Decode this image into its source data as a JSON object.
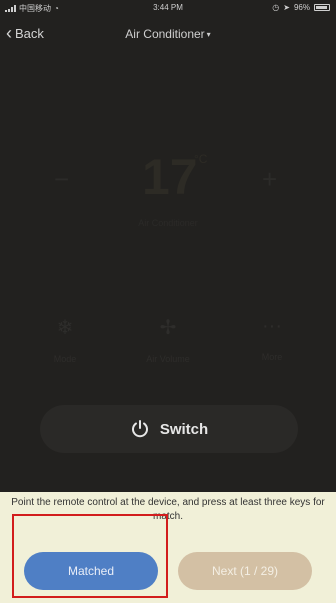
{
  "status_bar": {
    "carrier": "中国移动",
    "time": "3:44 PM",
    "battery": "96%"
  },
  "nav": {
    "back_label": "Back",
    "title": "Air Conditioner"
  },
  "climate": {
    "minus": "−",
    "plus": "+",
    "temperature": "17",
    "unit": "°C",
    "mode_text": "Air Conditioner"
  },
  "modes": [
    {
      "icon": "snowflake-icon",
      "label": "Mode"
    },
    {
      "icon": "fan-icon",
      "label": "Air Volume"
    },
    {
      "icon": "more-icon",
      "label": "More"
    }
  ],
  "switch": {
    "label": "Switch"
  },
  "match_panel": {
    "hint": "Point the remote control at the device, and press at least three keys for match.",
    "matched_label": "Matched",
    "next_label": "Next (1 / 29)"
  },
  "colors": {
    "background": "#22211f",
    "panel": "#f1f0d8",
    "matched_button": "#4f7fc5",
    "next_button": "#d3c0a4",
    "highlight": "#d21d1d"
  }
}
